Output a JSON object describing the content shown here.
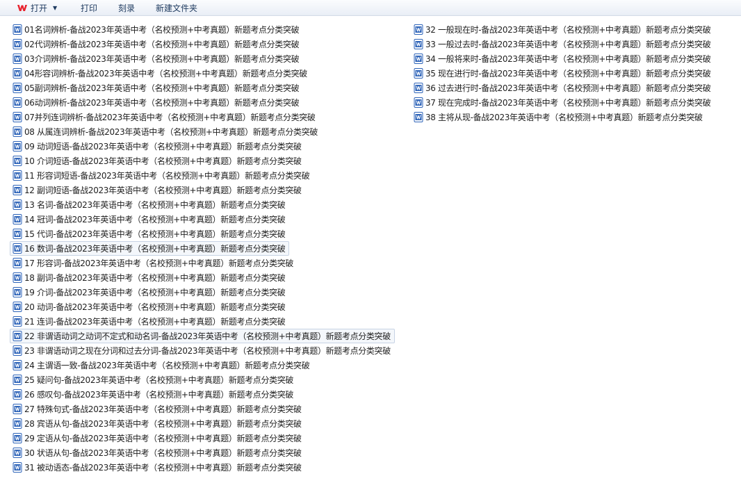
{
  "toolbar": {
    "open_label": "打开",
    "print_label": "打印",
    "burn_label": "刻录",
    "new_folder_label": "新建文件夹"
  },
  "files": [
    "01名词辨析-备战2023年英语中考（名校预测+中考真题）新题考点分类突破",
    "02代词辨析-备战2023年英语中考（名校预测+中考真题）新题考点分类突破",
    "03介词辨析-备战2023年英语中考（名校预测+中考真题）新题考点分类突破",
    "04形容词辨析-备战2023年英语中考（名校预测+中考真题）新题考点分类突破",
    "05副词辨析-备战2023年英语中考（名校预测+中考真题）新题考点分类突破",
    "06动词辨析-备战2023年英语中考（名校预测+中考真题）新题考点分类突破",
    "07并列连词辨析-备战2023年英语中考（名校预测+中考真题）新题考点分类突破",
    "08 从属连词辨析-备战2023年英语中考（名校预测+中考真题）新题考点分类突破",
    "09 动词短语-备战2023年英语中考（名校预测+中考真题）新题考点分类突破",
    "10 介词短语-备战2023年英语中考（名校预测+中考真题）新题考点分类突破",
    "11 形容词短语-备战2023年英语中考（名校预测+中考真题）新题考点分类突破",
    "12 副词短语-备战2023年英语中考（名校预测+中考真题）新题考点分类突破",
    "13 名词-备战2023年英语中考（名校预测+中考真题）新题考点分类突破",
    "14 冠词-备战2023年英语中考（名校预测+中考真题）新题考点分类突破",
    "15 代词-备战2023年英语中考（名校预测+中考真题）新题考点分类突破",
    "16 数词-备战2023年英语中考（名校预测+中考真题）新题考点分类突破",
    "17 形容词-备战2023年英语中考（名校预测+中考真题）新题考点分类突破",
    "18 副词-备战2023年英语中考（名校预测+中考真题）新题考点分类突破",
    "19 介词-备战2023年英语中考（名校预测+中考真题）新题考点分类突破",
    "20 动词-备战2023年英语中考（名校预测+中考真题）新题考点分类突破",
    "21 连词-备战2023年英语中考（名校预测+中考真题）新题考点分类突破",
    "22 非谓语动词之动词不定式和动名词-备战2023年英语中考（名校预测+中考真题）新题考点分类突破",
    "23 非谓语动词之现在分词和过去分词-备战2023年英语中考（名校预测+中考真题）新题考点分类突破",
    "24 主谓语一致-备战2023年英语中考（名校预测+中考真题）新题考点分类突破",
    "25 疑问句-备战2023年英语中考（名校预测+中考真题）新题考点分类突破",
    "26 感叹句-备战2023年英语中考（名校预测+中考真题）新题考点分类突破",
    "27 特殊句式-备战2023年英语中考（名校预测+中考真题）新题考点分类突破",
    "28 宾语从句-备战2023年英语中考（名校预测+中考真题）新题考点分类突破",
    "29 定语从句-备战2023年英语中考（名校预测+中考真题）新题考点分类突破",
    "30 状语从句-备战2023年英语中考（名校预测+中考真题）新题考点分类突破",
    "31 被动语态-备战2023年英语中考（名校预测+中考真题）新题考点分类突破",
    "32 一般现在时-备战2023年英语中考（名校预测+中考真题）新题考点分类突破",
    "33 一般过去时-备战2023年英语中考（名校预测+中考真题）新题考点分类突破",
    "34 一般将来时-备战2023年英语中考（名校预测+中考真题）新题考点分类突破",
    "35 现在进行时-备战2023年英语中考（名校预测+中考真题）新题考点分类突破",
    "36 过去进行时-备战2023年英语中考（名校预测+中考真题）新题考点分类突破",
    "37 现在完成时-备战2023年英语中考（名校预测+中考真题）新题考点分类突破",
    "38 主将从现-备战2023年英语中考（名校预测+中考真题）新题考点分类突破"
  ]
}
